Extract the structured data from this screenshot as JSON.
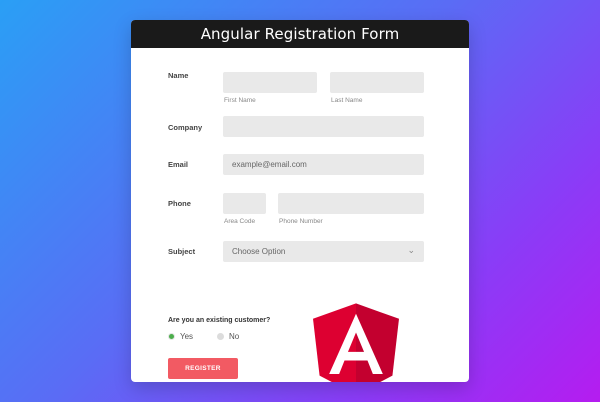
{
  "header": {
    "title": "Angular Registration Form"
  },
  "form": {
    "name": {
      "label": "Name",
      "first_sublabel": "First Name",
      "last_sublabel": "Last Name",
      "first_value": "",
      "last_value": ""
    },
    "company": {
      "label": "Company",
      "value": ""
    },
    "email": {
      "label": "Email",
      "placeholder": "example@email.com"
    },
    "phone": {
      "label": "Phone",
      "area_sublabel": "Area Code",
      "number_sublabel": "Phone Number"
    },
    "subject": {
      "label": "Subject",
      "selected": "Choose Option",
      "chevron": "⌄"
    },
    "existing_customer": {
      "question": "Are you an existing customer?",
      "options": [
        "Yes",
        "No"
      ],
      "selected": "Yes"
    },
    "register_label": "REGISTER"
  },
  "logo": {
    "letter": "A",
    "icon": "angular-logo-icon",
    "colors": {
      "left": "#dd0031",
      "right": "#c3002f",
      "letter": "#ffffff"
    }
  },
  "colors": {
    "header_bg": "#1a1a1a",
    "register_bg": "#f25a63",
    "radio_selected": "#4cae4c",
    "input_bg": "#e9e9e9"
  }
}
